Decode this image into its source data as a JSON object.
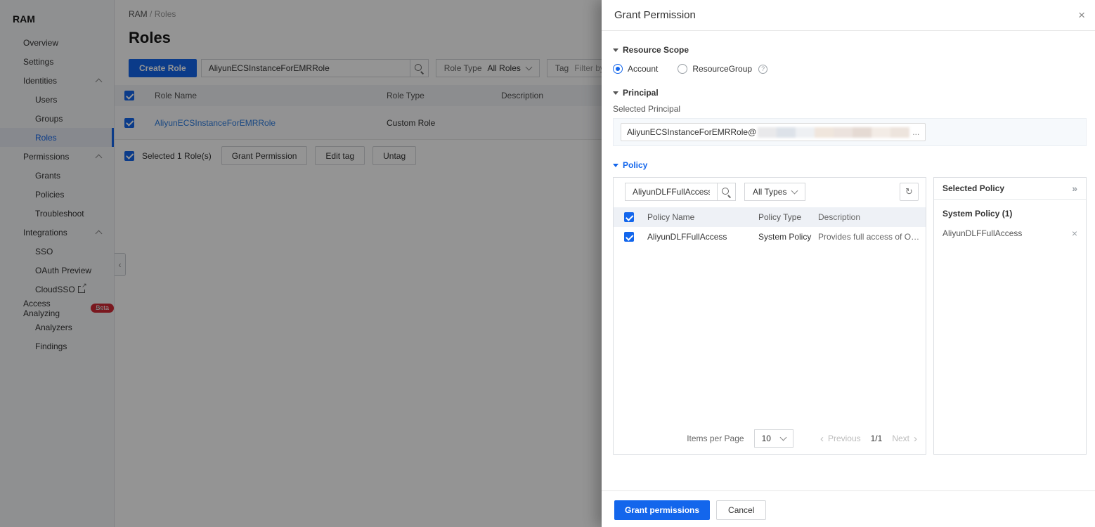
{
  "sidebar": {
    "title": "RAM",
    "items": [
      {
        "label": "Overview"
      },
      {
        "label": "Settings"
      },
      {
        "label": "Identities"
      },
      {
        "label": "Users"
      },
      {
        "label": "Groups"
      },
      {
        "label": "Roles"
      },
      {
        "label": "Permissions"
      },
      {
        "label": "Grants"
      },
      {
        "label": "Policies"
      },
      {
        "label": "Troubleshoot"
      },
      {
        "label": "Integrations"
      },
      {
        "label": "SSO"
      },
      {
        "label": "OAuth Preview"
      },
      {
        "label": "CloudSSO"
      },
      {
        "label": "Access Analyzing",
        "badge": "Beta"
      },
      {
        "label": "Analyzers"
      },
      {
        "label": "Findings"
      }
    ]
  },
  "main": {
    "breadcrumb": {
      "root": "RAM",
      "separator": "/",
      "current": "Roles"
    },
    "page_title": "Roles",
    "toolbar": {
      "create_role_label": "Create Role",
      "search_value": "AliyunECSInstanceForEMRRole",
      "role_type_label": "Role Type",
      "role_type_value": "All Roles",
      "tag_label": "Tag",
      "tag_placeholder": "Filter by tag"
    },
    "table": {
      "columns": [
        "Role Name",
        "Role Type",
        "Description"
      ],
      "rows": [
        {
          "role_name": "AliyunECSInstanceForEMRRole",
          "role_type": "Custom Role",
          "description": ""
        }
      ]
    },
    "selection_bar": {
      "selected_text": "Selected 1 Role(s)",
      "grant_permission_label": "Grant Permission",
      "edit_tag_label": "Edit tag",
      "untag_label": "Untag"
    }
  },
  "drawer": {
    "title": "Grant Permission",
    "close_icon": "×",
    "resource_scope": {
      "heading": "Resource Scope",
      "account_label": "Account",
      "resource_group_label": "ResourceGroup"
    },
    "principal": {
      "heading": "Principal",
      "label": "Selected Principal",
      "value_prefix": "AliyunECSInstanceForEMRRole@",
      "value_suffix": "..."
    },
    "policy": {
      "heading": "Policy",
      "search_value": "AliyunDLFFullAccess",
      "type_filter_value": "All Types",
      "table": {
        "columns": [
          "Policy Name",
          "Policy Type",
          "Description"
        ],
        "rows": [
          {
            "name": "AliyunDLFFullAccess",
            "type": "System Policy",
            "description": "Provides full access of OpenAPI ..."
          }
        ]
      },
      "pagination": {
        "items_per_page_label": "Items per Page",
        "items_per_page_value": "10",
        "previous_label": "Previous",
        "page_indicator": "1/1",
        "next_label": "Next"
      },
      "selected_panel": {
        "title": "Selected Policy",
        "collapse_icon": "»",
        "group_title": "System Policy (1)",
        "item": "AliyunDLFFullAccess",
        "remove_icon": "×"
      }
    },
    "footer": {
      "confirm_label": "Grant permissions",
      "cancel_label": "Cancel"
    }
  },
  "colors": {
    "accent": "#1366EC",
    "link": "#2E7CE0",
    "beta_badge": "#D22A36"
  }
}
